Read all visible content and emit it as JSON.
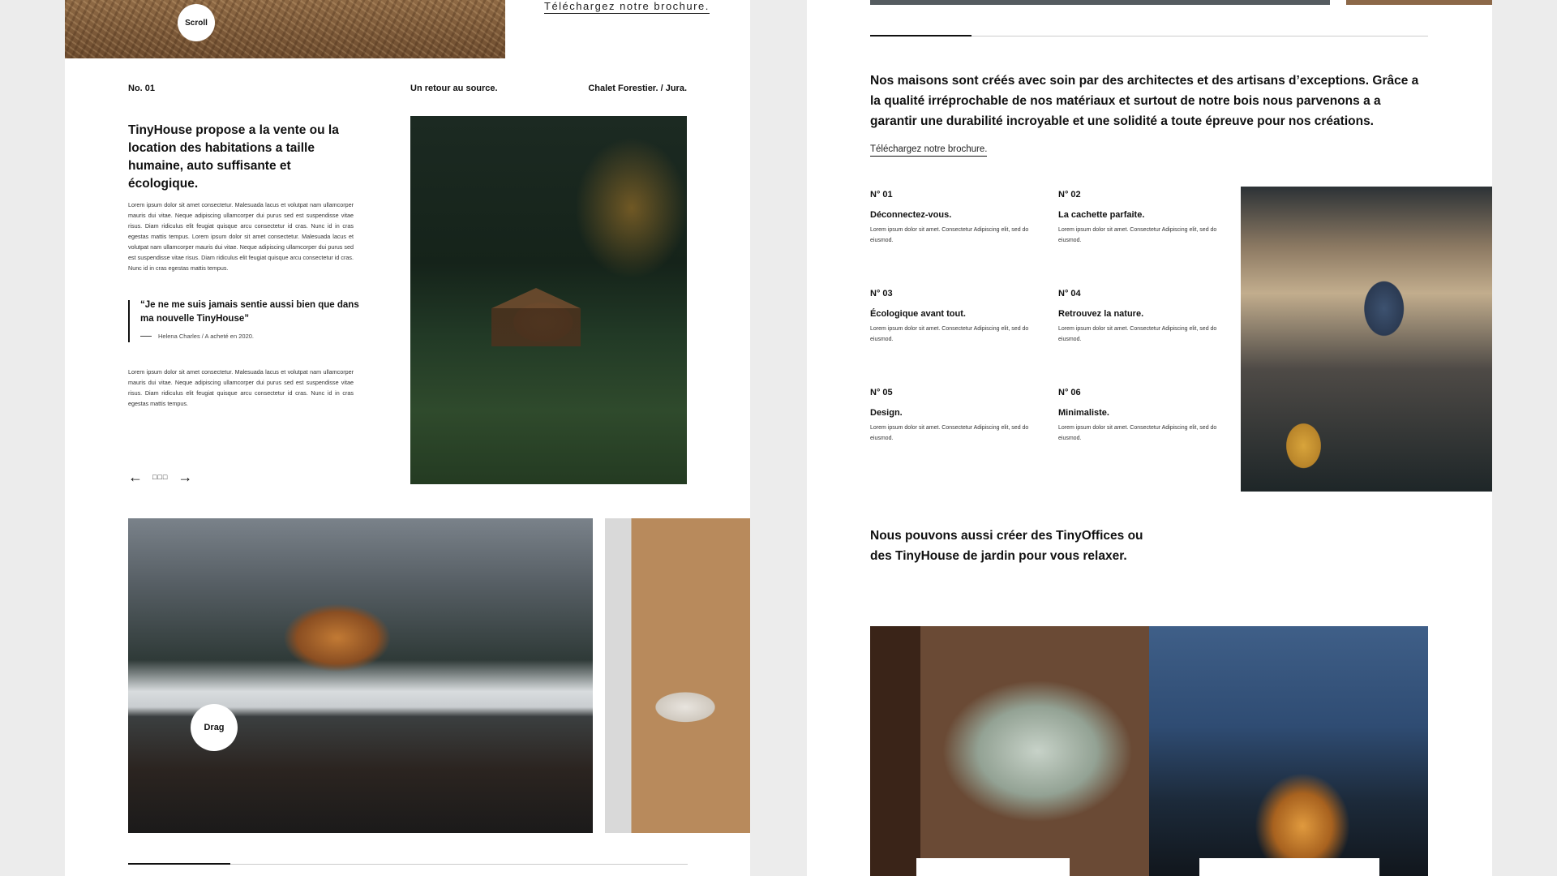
{
  "left": {
    "scroll_label": "Scroll",
    "top_link": "Téléchargez notre brochure.",
    "meta": {
      "number": "No. 01",
      "tagline": "Un retour au source.",
      "place": "Chalet Forestier. / Jura."
    },
    "lead": "TinyHouse propose a la vente ou la location des habitations a taille humaine, auto suffisante et écologique.",
    "lorem_1": "Lorem ipsum dolor sit amet consectetur. Malesuada lacus et volutpat nam ullamcorper mauris dui vitae. Neque adipiscing ullamcorper dui purus sed est suspendisse vitae risus. Diam ridiculus elit feugiat quisque arcu consectetur id cras. Nunc id in cras egestas mattis tempus. Lorem ipsum dolor sit amet consectetur. Malesuada lacus et volutpat nam ullamcorper mauris dui vitae. Neque adipiscing ullamcorper dui purus sed est suspendisse vitae risus. Diam ridiculus elit feugiat quisque arcu consectetur id cras. Nunc id in cras egestas mattis tempus.",
    "quote": "“Je ne me suis jamais sentie aussi bien que dans ma nouvelle TinyHouse”",
    "quote_author": "Helena Charles / A acheté en 2020.",
    "lorem_2": "Lorem ipsum dolor sit amet consectetur. Malesuada lacus et volutpat nam ullamcorper mauris dui vitae. Neque adipiscing ullamcorper dui purus sed est suspendisse vitae risus. Diam ridiculus elit feugiat quisque arcu consectetur id cras. Nunc id in cras egestas mattis tempus.",
    "nav": {
      "prev_icon": "←",
      "dots": "□□□",
      "next_icon": "→"
    },
    "drag_label": "Drag",
    "carousel_progress": 0.18
  },
  "right": {
    "intro": "Nos maisons sont créés avec soin par des architectes et des artisans d’exceptions. Grâce a la qualité irréprochable de nos matériaux et surtout de notre bois nous parvenons a a garantir une durabilité incroyable et une solidité a toute épreuve pour nos créations.",
    "link": "Téléchargez notre brochure.",
    "features": [
      {
        "num": "N° 01",
        "title": "Déconnectez-vous.",
        "text": "Lorem ipsum dolor sit amet. Consectetur Adipiscing elit, sed do eiusmod."
      },
      {
        "num": "N° 02",
        "title": "La cachette parfaite.",
        "text": "Lorem ipsum dolor sit amet. Consectetur Adipiscing elit, sed do eiusmod."
      },
      {
        "num": "N° 03",
        "title": "Écologique avant tout.",
        "text": "Lorem ipsum dolor sit amet. Consectetur Adipiscing elit, sed do eiusmod."
      },
      {
        "num": "N° 04",
        "title": "Retrouvez la nature.",
        "text": "Lorem ipsum dolor sit amet. Consectetur Adipiscing elit, sed do eiusmod."
      },
      {
        "num": "N° 05",
        "title": "Design.",
        "text": "Lorem ipsum dolor sit amet. Consectetur Adipiscing elit, sed do eiusmod."
      },
      {
        "num": "N° 06",
        "title": "Minimaliste.",
        "text": "Lorem ipsum dolor sit amet. Consectetur Adipiscing elit, sed do eiusmod."
      }
    ],
    "sub": "Nous pouvons aussi créer des TinyOffices ou des TinyHouse de jardin pour vous relaxer.",
    "carousel_progress": 0.18
  },
  "colors": {
    "background": "#ececec",
    "panel": "#ffffff",
    "text": "#111111",
    "track": "#cccccc"
  }
}
